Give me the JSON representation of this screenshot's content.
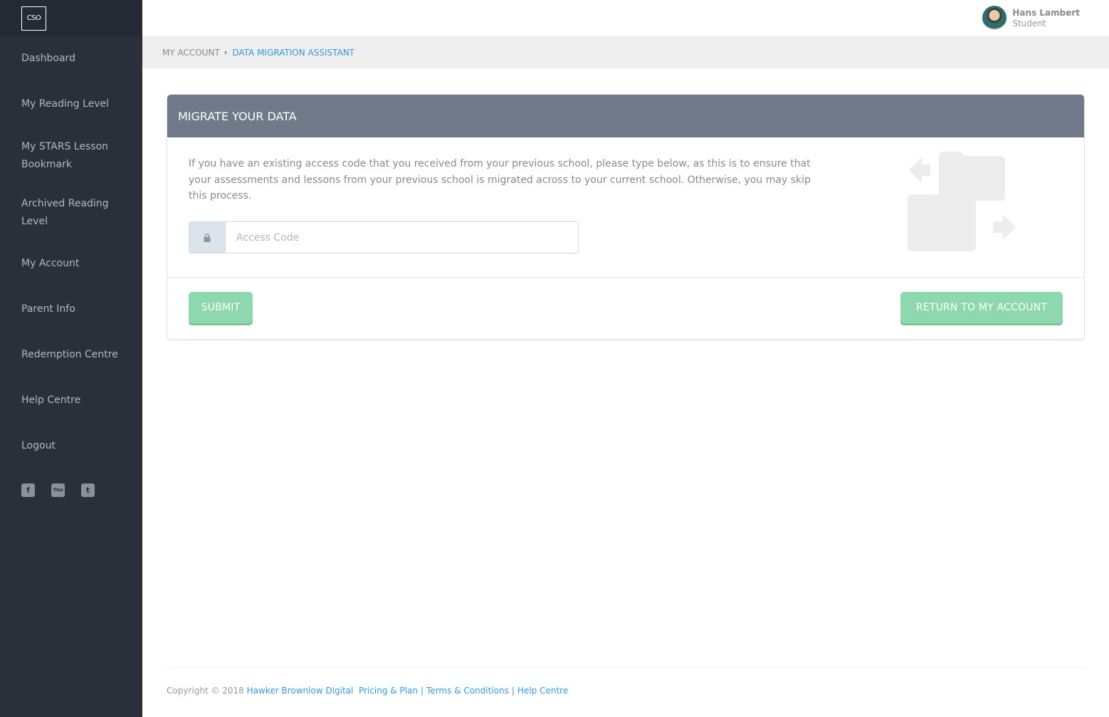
{
  "app": {
    "logo_text": "CSO"
  },
  "sidebar": {
    "items": [
      {
        "label": "Dashboard"
      },
      {
        "label": "My Reading Level"
      },
      {
        "label": "My STARS Lesson Bookmark"
      },
      {
        "label": "Archived Reading Level"
      },
      {
        "label": "My Account"
      },
      {
        "label": "Parent Info"
      },
      {
        "label": "Redemption Centre"
      },
      {
        "label": "Help Centre"
      },
      {
        "label": "Logout"
      }
    ],
    "social": [
      {
        "icon": "facebook-icon",
        "glyph": "f"
      },
      {
        "icon": "youtube-icon",
        "glyph": "You"
      },
      {
        "icon": "twitter-icon",
        "glyph": "t"
      }
    ]
  },
  "header": {
    "user_name": "Hans Lambert",
    "user_role": "Student"
  },
  "breadcrumb": {
    "parent": "MY ACCOUNT",
    "current": "DATA MIGRATION ASSISTANT"
  },
  "card": {
    "title": "MIGRATE YOUR DATA",
    "intro": "If you have an existing access code that you received from your previous school, please type below, as this is to ensure that your assessments and lessons from your previous school is migrated across to your current school. Otherwise, you may skip this process.",
    "access_code": {
      "value": "",
      "placeholder": "Access Code"
    },
    "submit_label": "SUBMIT",
    "return_label": "RETURN TO MY ACCOUNT"
  },
  "footer": {
    "copyright": "Copyright © 2018",
    "company": "Hawker Brownlow Digital",
    "links": [
      "Pricing & Plan",
      "Terms & Conditions",
      "Help Centre"
    ]
  },
  "colors": {
    "sidebar_bg": "#2b2f3a",
    "card_header": "#70798a",
    "button": "#8dd9ad",
    "link": "#3498db"
  }
}
